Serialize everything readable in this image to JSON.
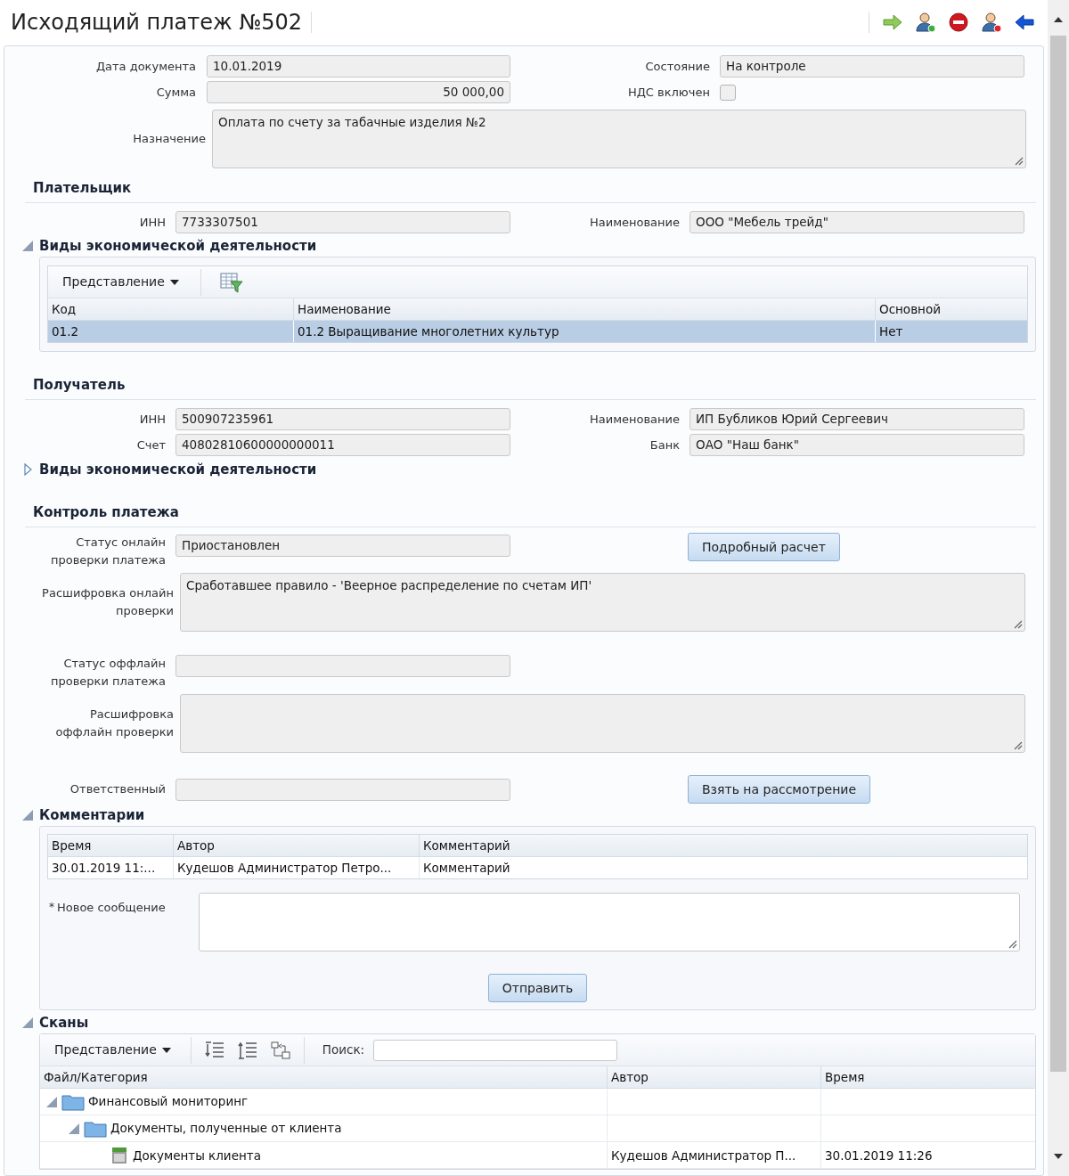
{
  "title": "Исходящий платеж №502",
  "document": {
    "date_label": "Дата документа",
    "date": "10.01.2019",
    "state_label": "Состояние",
    "state": "На контроле",
    "sum_label": "Сумма",
    "sum": "50 000,00",
    "vat_label": "НДС включен",
    "vat_included": false,
    "purpose_label": "Назначение",
    "purpose": "Оплата по счету за табачные изделия №2"
  },
  "payer": {
    "heading": "Плательщик",
    "inn_label": "ИНН",
    "inn": "7733307501",
    "name_label": "Наименование",
    "name": "ООО \"Мебель трейд\"",
    "activities": {
      "heading": "Виды экономической деятельности",
      "expanded": true,
      "view_button": "Представление",
      "columns": [
        "Код",
        "Наименование",
        "Основной"
      ],
      "rows": [
        {
          "cells": [
            "01.2",
            "01.2 Выращивание многолетних культур",
            "Нет"
          ],
          "selected": true
        }
      ]
    }
  },
  "recipient": {
    "heading": "Получатель",
    "inn_label": "ИНН",
    "inn": "500907235961",
    "name_label": "Наименование",
    "name": "ИП Бубликов Юрий Сергеевич",
    "account_label": "Счет",
    "account": "40802810600000000011",
    "bank_label": "Банк",
    "bank": "ОАО \"Наш банк\"",
    "activities": {
      "heading": "Виды экономической деятельности",
      "expanded": false
    }
  },
  "control": {
    "heading": "Контроль платежа",
    "online_status_label": "Статус онлайн проверки платежа",
    "online_status": "Приостановлен",
    "details_button": "Подробный расчет",
    "online_details_label": "Расшифровка онлайн проверки",
    "online_details": "Сработавшее правило - 'Веерное распределение по счетам ИП'",
    "offline_status_label": "Статус оффлайн проверки платежа",
    "offline_details_label": "Расшифровка оффлайн проверки",
    "responsible_label": "Ответственный",
    "take_button": "Взять на рассмотрение"
  },
  "comments": {
    "heading": "Комментарии",
    "expanded": true,
    "columns": [
      "Время",
      "Автор",
      "Комментарий"
    ],
    "rows": [
      {
        "cells": [
          "30.01.2019 11:...",
          "Кудешов Администратор Петро...",
          "Комментарий"
        ]
      }
    ],
    "required_mark": "*",
    "new_message_label": "Новое сообщение",
    "send_button": "Отправить"
  },
  "scans": {
    "heading": "Сканы",
    "expanded": true,
    "view_button": "Представление",
    "search_label": "Поиск:",
    "columns": [
      "Файл/Категория",
      "Автор",
      "Время"
    ],
    "tree": [
      {
        "kind": "folder",
        "label": "Финансовый мониторинг",
        "expanded": true,
        "children": [
          {
            "kind": "folder",
            "label": "Документы, полученные от клиента",
            "expanded": true,
            "children": [
              {
                "kind": "document",
                "label": "Документы клиента",
                "author": "Кудешов Администратор П...",
                "time": "30.01.2019 11:26"
              }
            ]
          }
        ]
      }
    ]
  }
}
